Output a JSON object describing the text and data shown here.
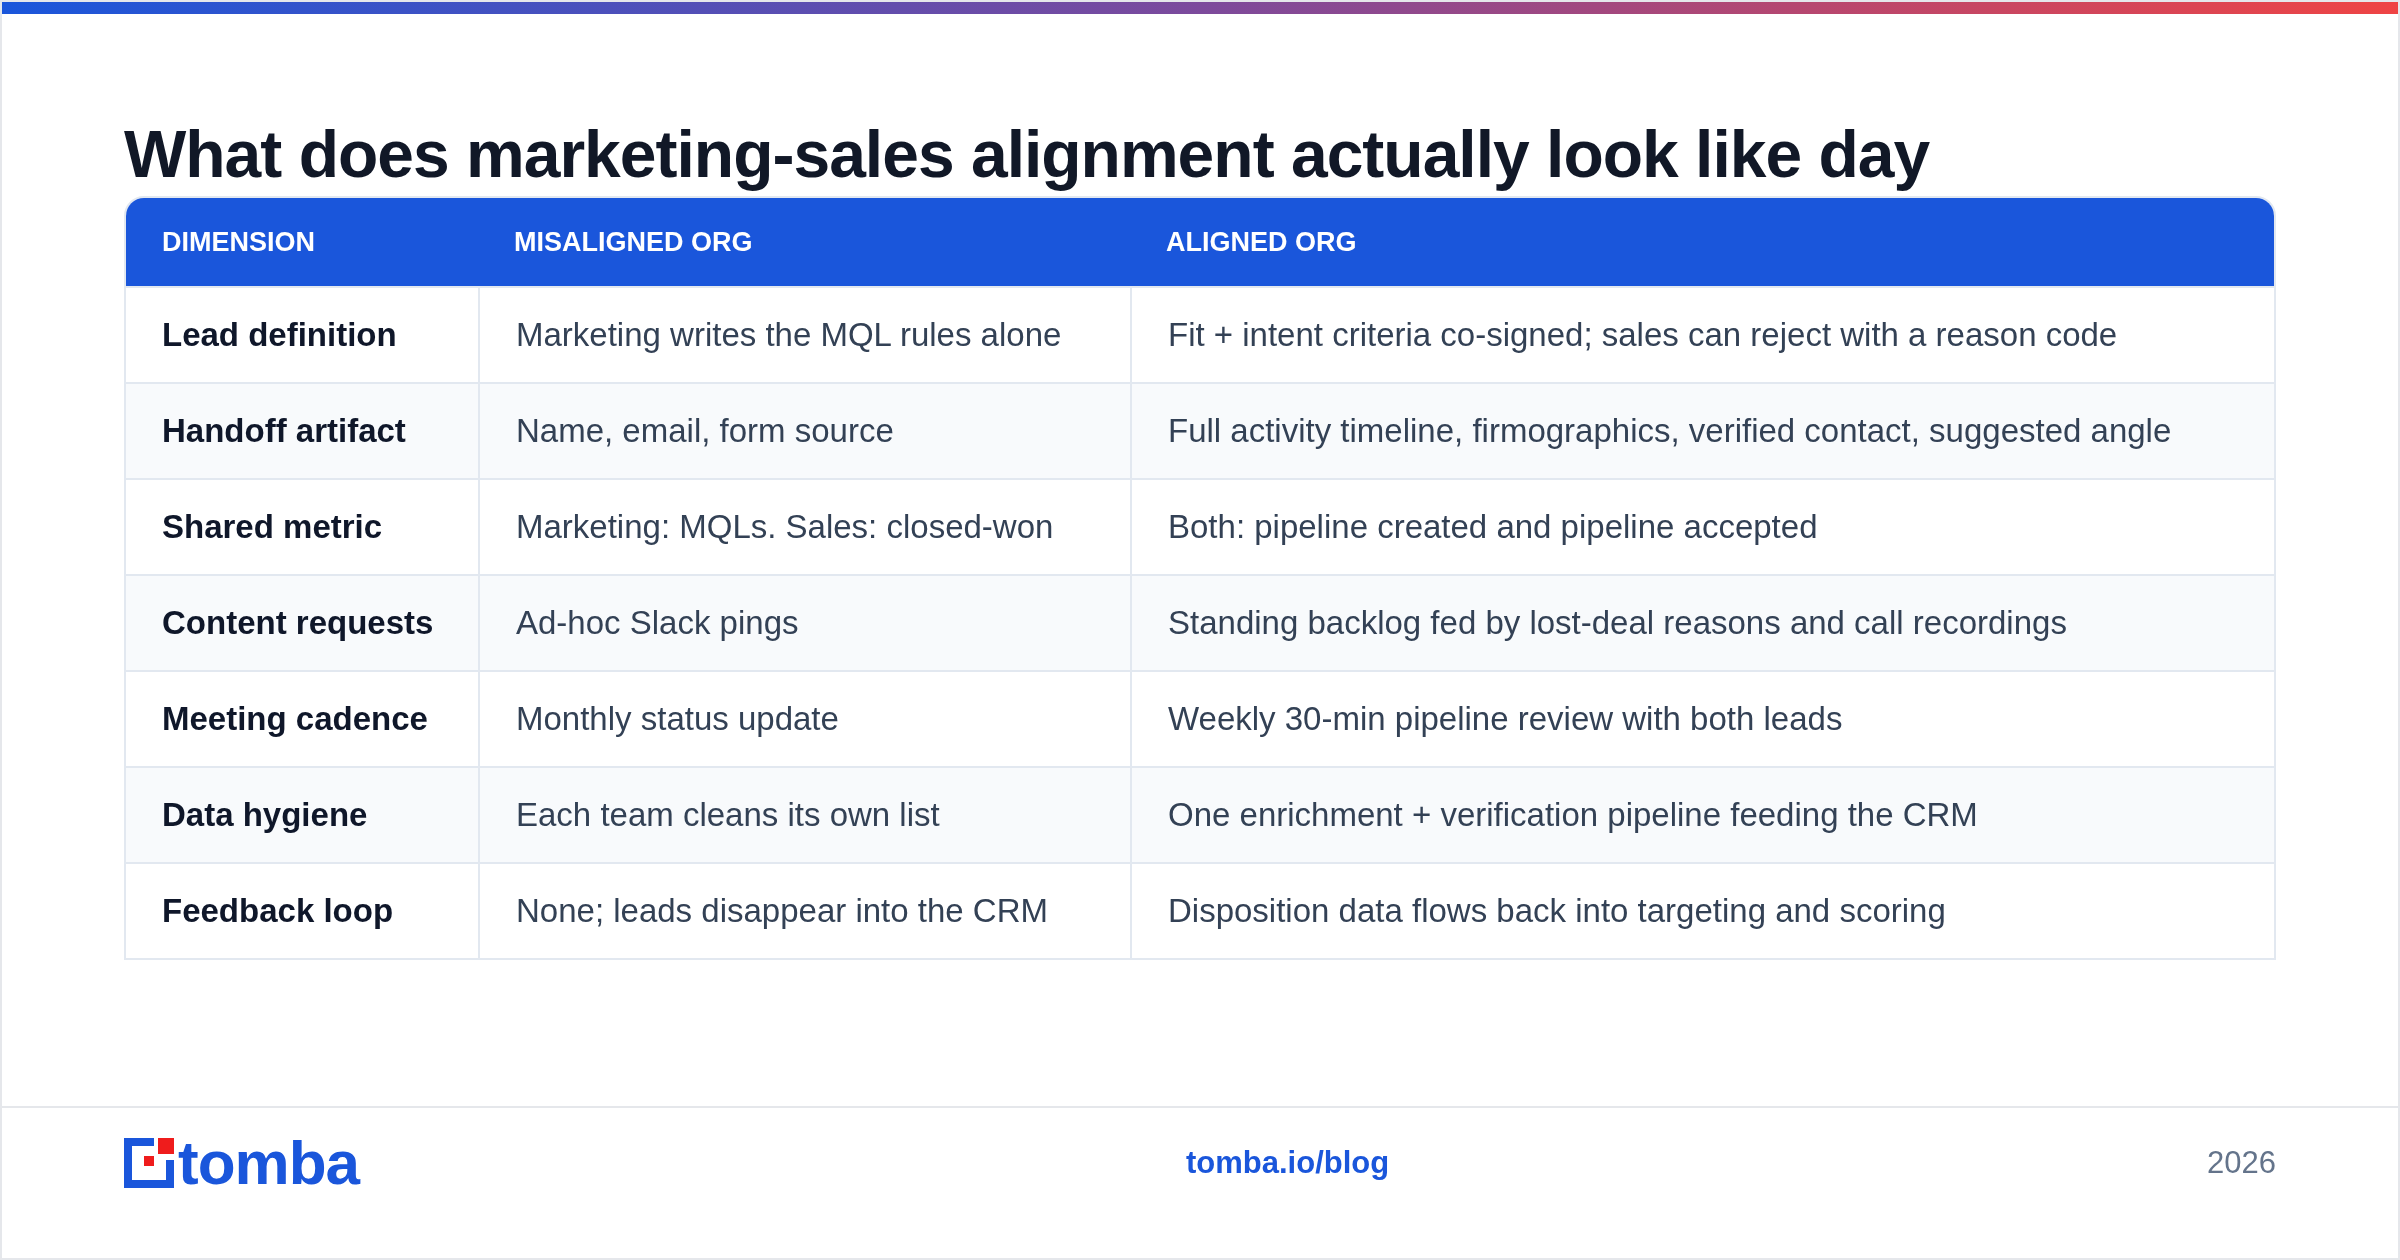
{
  "title": "What does marketing-sales alignment actually look like day",
  "table": {
    "columns": [
      "DIMENSION",
      "MISALIGNED ORG",
      "ALIGNED ORG"
    ],
    "rows": [
      {
        "dimension": "Lead definition",
        "misaligned": "Marketing writes the MQL rules alone",
        "aligned": "Fit + intent criteria co-signed; sales can reject with a reason code"
      },
      {
        "dimension": "Handoff artifact",
        "misaligned": "Name, email, form source",
        "aligned": "Full activity timeline, firmographics, verified contact, suggested angle"
      },
      {
        "dimension": "Shared metric",
        "misaligned": "Marketing: MQLs. Sales: closed-won",
        "aligned": "Both: pipeline created and pipeline accepted"
      },
      {
        "dimension": "Content requests",
        "misaligned": "Ad-hoc Slack pings",
        "aligned": "Standing backlog fed by lost-deal reasons and call recordings"
      },
      {
        "dimension": "Meeting cadence",
        "misaligned": "Monthly status update",
        "aligned": "Weekly 30-min pipeline review with both leads"
      },
      {
        "dimension": "Data hygiene",
        "misaligned": "Each team cleans its own list",
        "aligned": "One enrichment + verification pipeline feeding the CRM"
      },
      {
        "dimension": "Feedback loop",
        "misaligned": "None; leads disappear into the CRM",
        "aligned": "Disposition data flows back into targeting and scoring"
      }
    ]
  },
  "footer": {
    "logo": "tomba",
    "link": "tomba.io/blog",
    "year": "2026"
  }
}
